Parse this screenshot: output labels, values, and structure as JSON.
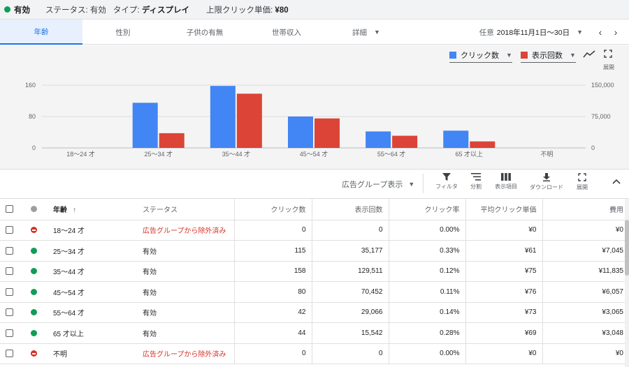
{
  "status_bar": {
    "enabled_label": "有効",
    "status_label": "ステータス:",
    "status_value": "有効",
    "type_label": "タイプ:",
    "type_value": "ディスプレイ",
    "cpc_label": "上限クリック単価:",
    "cpc_value": "¥80"
  },
  "tabs": [
    {
      "label": "年齢",
      "active": true
    },
    {
      "label": "性別",
      "active": false
    },
    {
      "label": "子供の有無",
      "active": false
    },
    {
      "label": "世帯収入",
      "active": false
    },
    {
      "label": "詳細",
      "active": false
    }
  ],
  "date_range": {
    "label": "任意",
    "value": "2018年11月1日～30日"
  },
  "chart_controls": {
    "metric1": "クリック数",
    "metric2": "表示回数",
    "expand_label": "展開"
  },
  "chart_data": {
    "type": "bar",
    "categories": [
      "18～24 才",
      "25～34 才",
      "35～44 才",
      "45～54 才",
      "55～64 才",
      "65 才以上",
      "不明"
    ],
    "series": [
      {
        "name": "クリック数",
        "axis": "left",
        "color": "#4285f4",
        "values": [
          0,
          115,
          158,
          80,
          42,
          44,
          0
        ]
      },
      {
        "name": "表示回数",
        "axis": "right",
        "color": "#db4437",
        "values": [
          0,
          35177,
          129511,
          70452,
          29066,
          15542,
          0
        ]
      }
    ],
    "y_left_ticks": [
      "0",
      "80",
      "160"
    ],
    "y_left_max": 160,
    "y_right_ticks": [
      "0",
      "75,000",
      "150,000"
    ],
    "y_right_max": 150000,
    "grid": true
  },
  "toolbar": {
    "view_selector": "広告グループ表示",
    "filter": "フィルタ",
    "segment": "分割",
    "columns": "表示項目",
    "download": "ダウンロード",
    "expand": "展開"
  },
  "table": {
    "headers": {
      "age": "年齢",
      "sort_arrow": "↑",
      "status": "ステータス",
      "clicks": "クリック数",
      "impressions": "表示回数",
      "ctr": "クリック率",
      "avg_cpc": "平均クリック単価",
      "cost": "費用"
    },
    "rows": [
      {
        "age": "18～24 才",
        "state": "excluded",
        "status": "広告グループから除外済み",
        "clicks": "0",
        "impressions": "0",
        "ctr": "0.00%",
        "avg_cpc": "¥0",
        "cost": "¥0"
      },
      {
        "age": "25～34 才",
        "state": "enabled",
        "status": "有効",
        "clicks": "115",
        "impressions": "35,177",
        "ctr": "0.33%",
        "avg_cpc": "¥61",
        "cost": "¥7,045"
      },
      {
        "age": "35～44 才",
        "state": "enabled",
        "status": "有効",
        "clicks": "158",
        "impressions": "129,511",
        "ctr": "0.12%",
        "avg_cpc": "¥75",
        "cost": "¥11,835"
      },
      {
        "age": "45～54 才",
        "state": "enabled",
        "status": "有効",
        "clicks": "80",
        "impressions": "70,452",
        "ctr": "0.11%",
        "avg_cpc": "¥76",
        "cost": "¥6,057"
      },
      {
        "age": "55～64 才",
        "state": "enabled",
        "status": "有効",
        "clicks": "42",
        "impressions": "29,066",
        "ctr": "0.14%",
        "avg_cpc": "¥73",
        "cost": "¥3,065"
      },
      {
        "age": "65 才以上",
        "state": "enabled",
        "status": "有効",
        "clicks": "44",
        "impressions": "15,542",
        "ctr": "0.28%",
        "avg_cpc": "¥69",
        "cost": "¥3,048"
      },
      {
        "age": "不明",
        "state": "excluded",
        "status": "広告グループから除外済み",
        "clicks": "0",
        "impressions": "0",
        "ctr": "0.00%",
        "avg_cpc": "¥0",
        "cost": "¥0"
      }
    ]
  },
  "colors": {
    "accent": "#1a73e8",
    "enabled": "#0f9d58",
    "excluded": "#d93025",
    "clicks_series": "#4285f4",
    "impressions_series": "#db4437"
  }
}
